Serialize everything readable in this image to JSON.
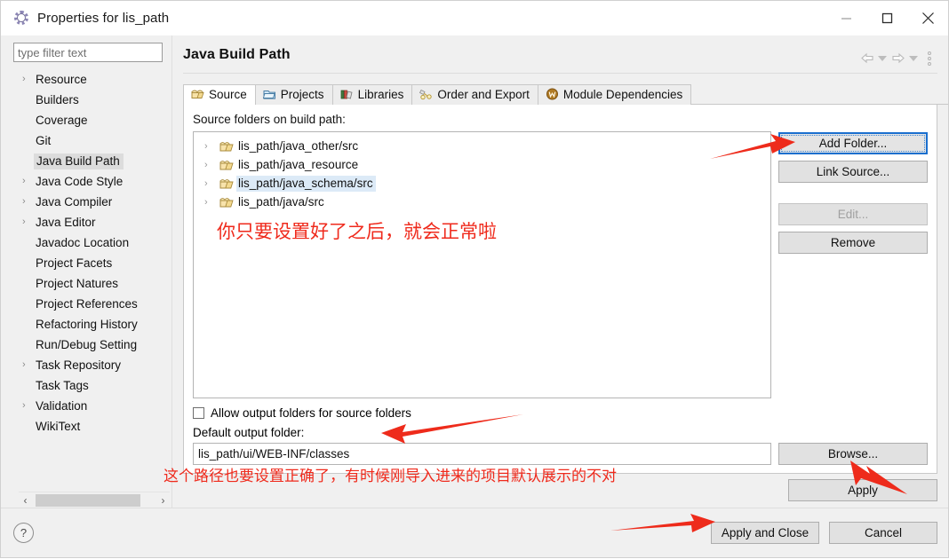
{
  "window": {
    "title": "Properties for lis_path",
    "icon": "eclipse-properties-icon",
    "controls": {
      "minimize": "–",
      "maximize": "□",
      "close": "✕"
    }
  },
  "sidebar": {
    "filter": {
      "placeholder": "type filter text",
      "value": ""
    },
    "items": [
      {
        "label": "Resource",
        "expandable": true,
        "selected": false
      },
      {
        "label": "Builders",
        "expandable": false,
        "selected": false
      },
      {
        "label": "Coverage",
        "expandable": false,
        "selected": false
      },
      {
        "label": "Git",
        "expandable": false,
        "selected": false
      },
      {
        "label": "Java Build Path",
        "expandable": false,
        "selected": true
      },
      {
        "label": "Java Code Style",
        "expandable": true,
        "selected": false
      },
      {
        "label": "Java Compiler",
        "expandable": true,
        "selected": false
      },
      {
        "label": "Java Editor",
        "expandable": true,
        "selected": false
      },
      {
        "label": "Javadoc Location",
        "expandable": false,
        "selected": false
      },
      {
        "label": "Project Facets",
        "expandable": false,
        "selected": false
      },
      {
        "label": "Project Natures",
        "expandable": false,
        "selected": false
      },
      {
        "label": "Project References",
        "expandable": false,
        "selected": false
      },
      {
        "label": "Refactoring History",
        "expandable": false,
        "selected": false
      },
      {
        "label": "Run/Debug Setting",
        "expandable": false,
        "selected": false
      },
      {
        "label": "Task Repository",
        "expandable": true,
        "selected": false
      },
      {
        "label": "Task Tags",
        "expandable": false,
        "selected": false
      },
      {
        "label": "Validation",
        "expandable": true,
        "selected": false
      },
      {
        "label": "WikiText",
        "expandable": false,
        "selected": false
      }
    ],
    "scroll": {
      "left_arrow": "‹",
      "right_arrow": "›"
    }
  },
  "page": {
    "title": "Java Build Path",
    "nav": {
      "back": "back-arrow-icon",
      "back_menu": "chevron-down-icon",
      "forward": "forward-arrow-icon",
      "forward_menu": "chevron-down-icon",
      "menu": "view-menu-icon"
    }
  },
  "tabs": [
    {
      "label": "Source",
      "icon": "source-folder-icon",
      "active": true
    },
    {
      "label": "Projects",
      "icon": "projects-icon",
      "active": false
    },
    {
      "label": "Libraries",
      "icon": "libraries-icon",
      "active": false
    },
    {
      "label": "Order and Export",
      "icon": "order-export-icon",
      "active": false
    },
    {
      "label": "Module Dependencies",
      "icon": "module-dependencies-icon",
      "active": false
    }
  ],
  "source_tab": {
    "list_label": "Source folders on build path:",
    "entries": [
      {
        "path": "lis_path/java_other/src",
        "selected": false
      },
      {
        "path": "lis_path/java_resource",
        "selected": false
      },
      {
        "path": "lis_path/java_schema/src",
        "selected": true
      },
      {
        "path": "lis_path/java/src",
        "selected": false
      }
    ],
    "buttons": [
      {
        "label": "Add Folder...",
        "mnemonic": "d",
        "state": "focused"
      },
      {
        "label": "Link Source...",
        "mnemonic": "n",
        "state": "normal"
      },
      {
        "label": "Edit...",
        "mnemonic": "E",
        "state": "disabled"
      },
      {
        "label": "Remove",
        "mnemonic": "R",
        "state": "normal"
      }
    ],
    "allow_output_checkbox": {
      "label": "Allow output folders for source folders",
      "checked": false
    },
    "default_output": {
      "label": "Default output folder:",
      "value": "lis_path/ui/WEB-INF/classes",
      "browse_label": "Browse..."
    }
  },
  "footer": {
    "apply_label": "Apply",
    "help_icon": "?",
    "apply_and_close_label": "Apply and Close",
    "cancel_label": "Cancel"
  },
  "annotations": [
    {
      "id": "annotation-source-folders",
      "text": "你只要设置好了之后，就会正常啦",
      "color": "#ef2a1c"
    },
    {
      "id": "annotation-output-path",
      "text": "这个路径也要设置正确了，有时候刚导入进来的项目默认展示的不对",
      "color": "#ef2a1c"
    }
  ],
  "colors": {
    "annotation_red": "#ef2a1c",
    "focus_blue": "#1a6fce",
    "selection_blue": "#dceaf7",
    "tree_selection_gray": "#dcdcdc",
    "dialog_gray": "#f0f0f0"
  }
}
